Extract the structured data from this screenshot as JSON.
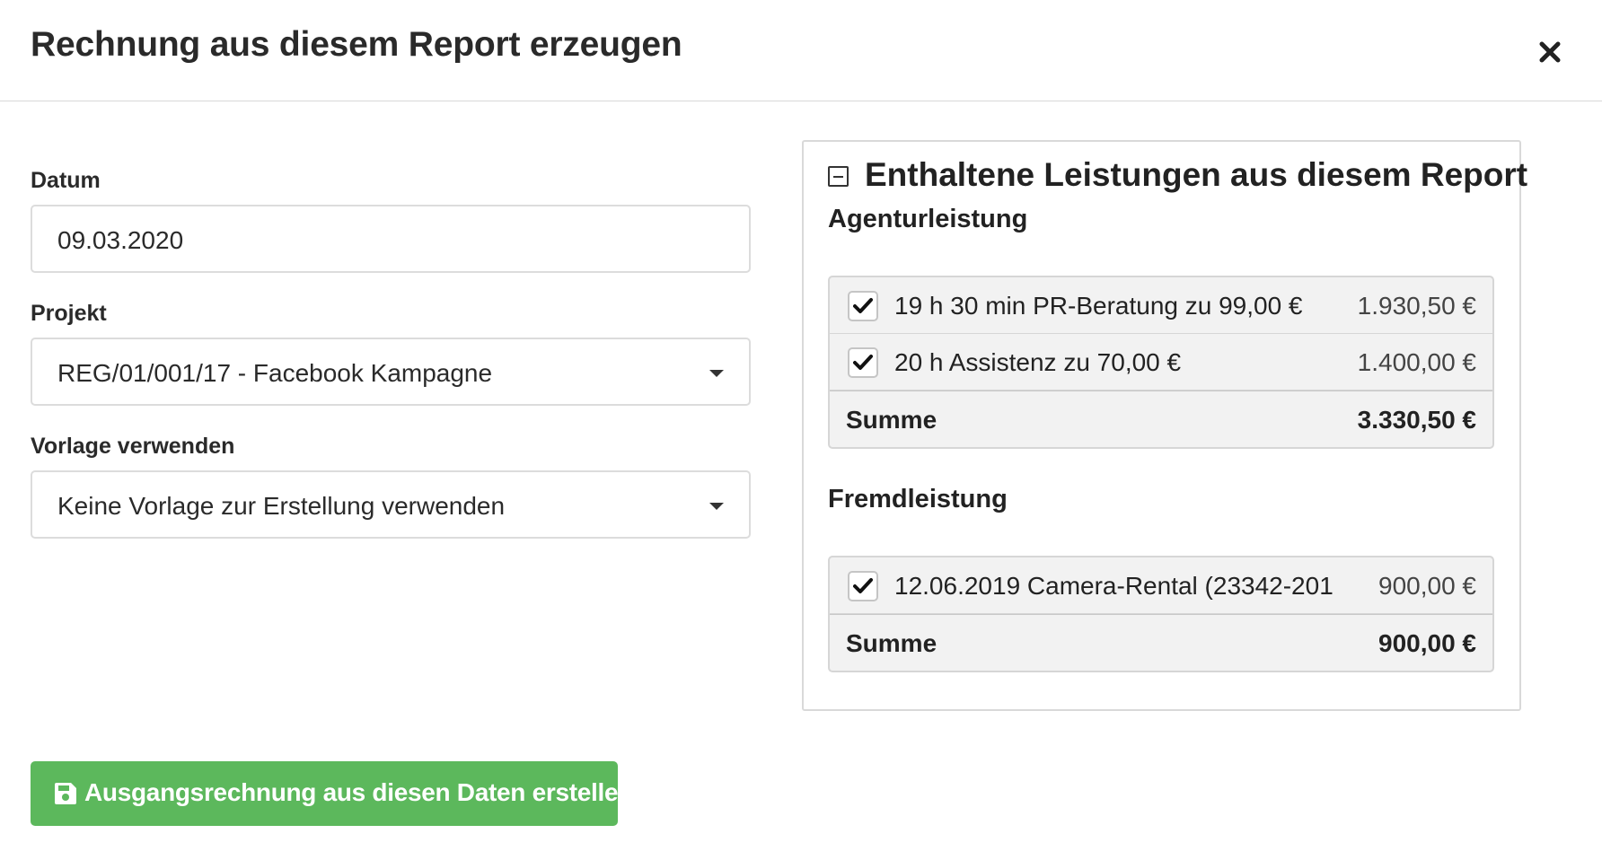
{
  "modal": {
    "title": "Rechnung aus diesem Report erzeugen",
    "close_icon": "close-icon"
  },
  "form": {
    "date": {
      "label": "Datum",
      "value": "09.03.2020"
    },
    "project": {
      "label": "Projekt",
      "value": "REG/01/001/17 - Facebook Kampagne"
    },
    "template": {
      "label": "Vorlage verwenden",
      "value": "Keine Vorlage zur Erstellung verwenden"
    }
  },
  "panel": {
    "title": "Enthaltene Leistungen aus diesem Report",
    "toggle_icon": "collapse-icon",
    "agency": {
      "title": "Agenturleistung",
      "items": [
        {
          "label": "19 h 30 min PR-Beratung zu 99,00 €",
          "amount": "1.930,50 €",
          "checked": true
        },
        {
          "label": "20 h Assistenz zu 70,00 €",
          "amount": "1.400,00 €",
          "checked": true
        }
      ],
      "sum_label": "Summe",
      "sum_amount": "3.330,50 €"
    },
    "external": {
      "title": "Fremdleistung",
      "items": [
        {
          "label": "12.06.2019 Camera-Rental (23342-201",
          "amount": "900,00 €",
          "checked": true
        }
      ],
      "sum_label": "Summe",
      "sum_amount": "900,00 €"
    }
  },
  "submit": {
    "label": "Ausgangsrechnung aus diesen Daten erstellen",
    "icon": "save-icon"
  },
  "colors": {
    "accent_green": "#5cb85c",
    "border": "#dcdcdc"
  }
}
